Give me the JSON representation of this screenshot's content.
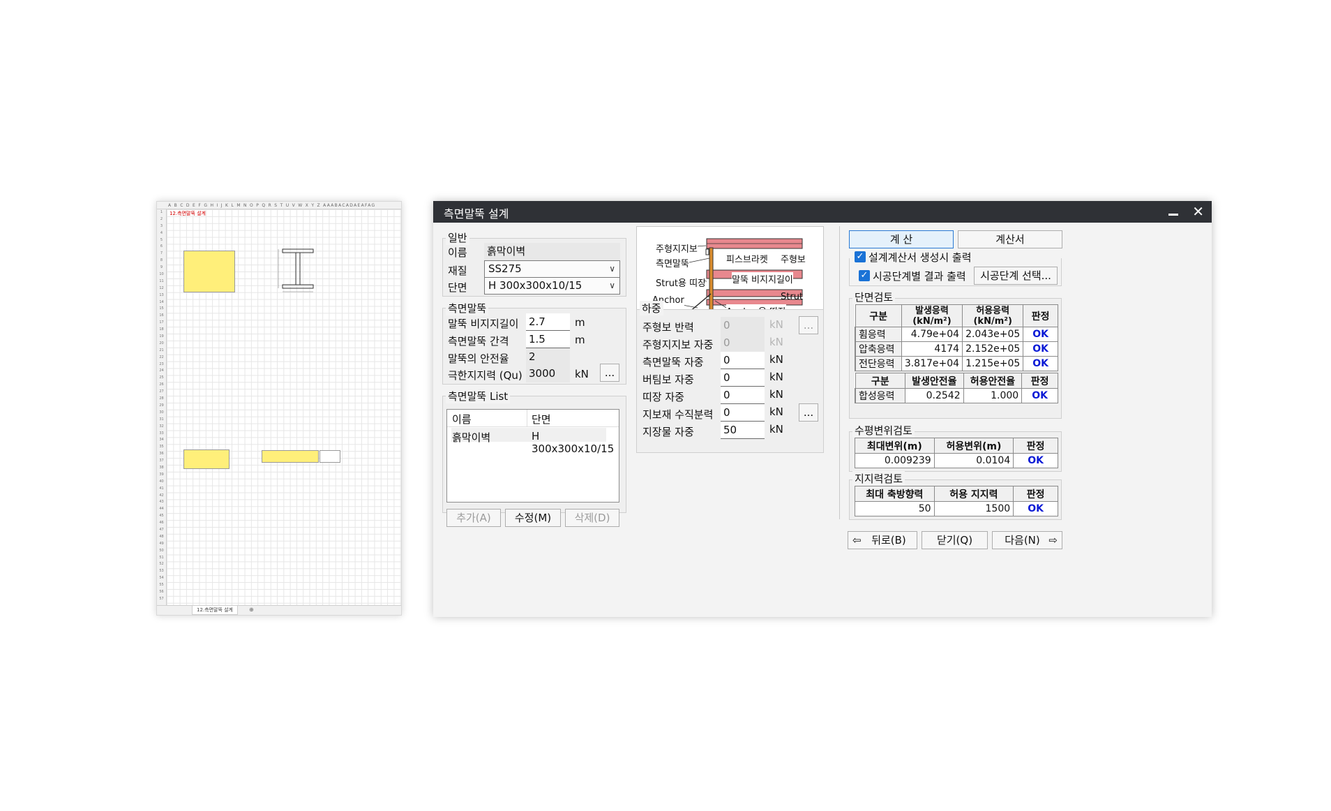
{
  "sheet": {
    "tab_label": "12.측면말뚝 설계",
    "col_header": "A B C D E F G H I J K L M N O P Q R S T U V W X Y Z AAABACADAEAFAG",
    "title": "12.측면말뚝 설계"
  },
  "dialog": {
    "title": "측면말뚝 설계",
    "general": {
      "group_title": "일반",
      "name_label": "이름",
      "name_value": "흙막이벽",
      "material_label": "재질",
      "material_value": "SS275",
      "section_label": "단면",
      "section_value": "H 300x300x10/15"
    },
    "pile": {
      "group_title": "측면말뚝",
      "length_label": "말뚝 비지지길이",
      "length_value": "2.7",
      "length_unit": "m",
      "spacing_label": "측면말뚝 간격",
      "spacing_value": "1.5",
      "spacing_unit": "m",
      "safety_label": "말뚝의 안전율",
      "safety_value": "2",
      "capacity_label": "극한지지력 (Qu)",
      "capacity_value": "3000",
      "capacity_unit": "kN",
      "more_label": "..."
    },
    "pile_list": {
      "group_title": "측면말뚝 List",
      "col_name": "이름",
      "col_section": "단면",
      "rows": [
        {
          "name": "흙막이벽",
          "section": "H 300x300x10/15"
        }
      ],
      "add_label": "추가(A)",
      "edit_label": "수정(M)",
      "delete_label": "삭제(D)"
    },
    "diagram": {
      "label_main_beam": "주형지지보",
      "label_side_pile": "측면말뚝",
      "label_piece_bracket": "피스브라켓",
      "label_main_girder": "주형보",
      "label_strut_wale": "Strut용 띠장",
      "label_unsupported": "말뚝 비지지길이",
      "label_anchor": "Anchor",
      "label_strut": "Strut",
      "label_anchor_wale": "Anchor용 띠장"
    },
    "load": {
      "group_title": "하중",
      "rows": [
        {
          "label": "주형보 반력",
          "value": "0",
          "unit": "kN",
          "disabled": true,
          "button": "..."
        },
        {
          "label": "주형지지보 자중",
          "value": "0",
          "unit": "kN",
          "disabled": true
        },
        {
          "label": "측면말뚝 자중",
          "value": "0",
          "unit": "kN"
        },
        {
          "label": "버팀보 자중",
          "value": "0",
          "unit": "kN"
        },
        {
          "label": "띠장 자중",
          "value": "0",
          "unit": "kN"
        },
        {
          "label": "지보재 수직분력",
          "value": "0",
          "unit": "kN",
          "button": "..."
        },
        {
          "label": "지장물 자중",
          "value": "50",
          "unit": "kN"
        }
      ]
    },
    "actions": {
      "calc_label": "계    산",
      "report_label": "계산서",
      "chk_report_label": "설계계산서 생성시 출력",
      "chk_stage_label": "시공단계별 결과 출력",
      "stage_select_label": "시공단계 선택..."
    },
    "section_check": {
      "group_title": "단면검토",
      "headers": [
        "구분",
        "발생응력\n(kN/m²)",
        "허용응력\n(kN/m²)",
        "판정"
      ],
      "rows": [
        {
          "name": "휨응력",
          "occur": "4.79e+04",
          "allow": "2.043e+05",
          "result": "OK"
        },
        {
          "name": "압축응력",
          "occur": "4174",
          "allow": "2.152e+05",
          "result": "OK"
        },
        {
          "name": "전단응력",
          "occur": "3.817e+04",
          "allow": "1.215e+05",
          "result": "OK"
        }
      ],
      "headers2": [
        "구분",
        "발생안전율",
        "허용안전율",
        "판정"
      ],
      "combined": {
        "name": "합성응력",
        "occur": "0.2542",
        "allow": "1.000",
        "result": "OK"
      }
    },
    "disp_check": {
      "group_title": "수평변위검토",
      "headers": [
        "최대변위(m)",
        "허용변위(m)",
        "판정"
      ],
      "row": {
        "max": "0.009239",
        "allow": "0.0104",
        "result": "OK"
      }
    },
    "bearing_check": {
      "group_title": "지지력검토",
      "headers": [
        "최대 축방향력",
        "허용 지지력",
        "판정"
      ],
      "row": {
        "max": "50",
        "allow": "1500",
        "result": "OK"
      }
    },
    "nav": {
      "back_label": "뒤로(B)",
      "close_label": "닫기(Q)",
      "next_label": "다음(N)"
    }
  }
}
